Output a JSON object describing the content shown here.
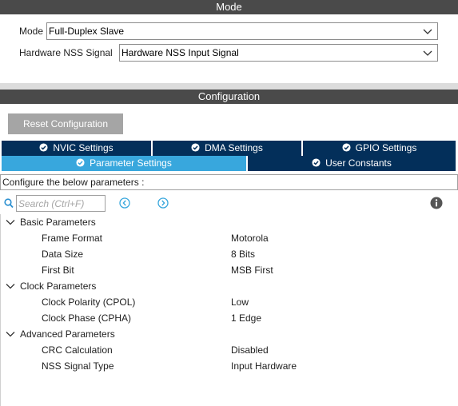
{
  "mode_section": {
    "title": "Mode",
    "fields": [
      {
        "label": "Mode",
        "value": "Full-Duplex Slave"
      },
      {
        "label": "Hardware NSS Signal",
        "value": "Hardware NSS Input Signal"
      }
    ]
  },
  "config_section": {
    "title": "Configuration",
    "reset_label": "Reset Configuration",
    "tabs_row1": [
      "NVIC Settings",
      "DMA Settings",
      "GPIO Settings"
    ],
    "tabs_row2": [
      "Parameter Settings",
      "User Constants"
    ],
    "active_tab": "Parameter Settings",
    "describe_text": "Configure the below parameters :",
    "search_placeholder": "Search (Ctrl+F)"
  },
  "groups": [
    {
      "label": "Basic Parameters",
      "params": [
        {
          "name": "Frame Format",
          "value": "Motorola"
        },
        {
          "name": "Data Size",
          "value": "8 Bits"
        },
        {
          "name": "First Bit",
          "value": "MSB First"
        }
      ]
    },
    {
      "label": "Clock Parameters",
      "params": [
        {
          "name": "Clock Polarity (CPOL)",
          "value": "Low"
        },
        {
          "name": "Clock Phase (CPHA)",
          "value": "1 Edge"
        }
      ]
    },
    {
      "label": "Advanced Parameters",
      "params": [
        {
          "name": "CRC Calculation",
          "value": "Disabled"
        },
        {
          "name": "NSS Signal Type",
          "value": "Input Hardware"
        }
      ]
    }
  ],
  "icons": {
    "tab_check": "check-circle-icon",
    "search": "search-icon",
    "prev": "chevron-left-circle-icon",
    "next": "chevron-right-circle-icon",
    "info": "info-icon",
    "expand": "chevron-down-icon"
  },
  "colors": {
    "header_bg": "#4a4a4a",
    "tab_bg": "#032f5a",
    "tab_active_bg": "#38a7dd",
    "reset_btn_bg": "#a5a5a5",
    "nav_icon": "#38a7dd",
    "info_icon": "#555555"
  }
}
